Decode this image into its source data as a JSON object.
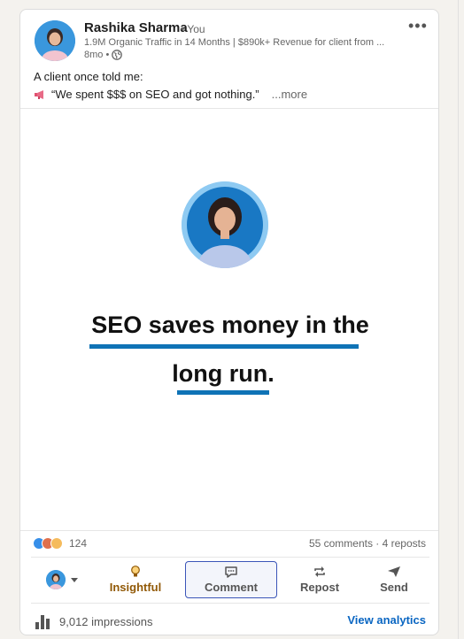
{
  "author": {
    "name": "Rashika Sharma",
    "you_tag": "• You",
    "headline": "1.9M Organic Traffic in 14 Months | $890k+ Revenue for client from ...",
    "time": "8mo •"
  },
  "post": {
    "line1": "A client once told me:",
    "line2": "“We spent $$$ on SEO and got nothing.”",
    "see_more": "...more"
  },
  "media": {
    "headline_line1": "SEO saves money in the",
    "headline_line2": "long run."
  },
  "social": {
    "reaction_count": "124",
    "comments_reposts": "55 comments · 4 reposts"
  },
  "actions": {
    "insightful": "Insightful",
    "comment": "Comment",
    "repost": "Repost",
    "send": "Send"
  },
  "footer": {
    "impressions": "9,012 impressions",
    "view_analytics": "View analytics"
  },
  "colors": {
    "accent_blue": "#0f73b6",
    "link_blue": "#0a66c2",
    "insightful": "#915907",
    "comment_border": "#3b55b8"
  },
  "icons": [
    "more-icon",
    "globe-icon",
    "megaphone-icon",
    "like-reaction-icon",
    "love-reaction-icon",
    "insightful-reaction-icon",
    "lightbulb-icon",
    "comment-icon",
    "repost-icon",
    "send-icon",
    "bar-chart-icon",
    "caret-down-icon"
  ]
}
